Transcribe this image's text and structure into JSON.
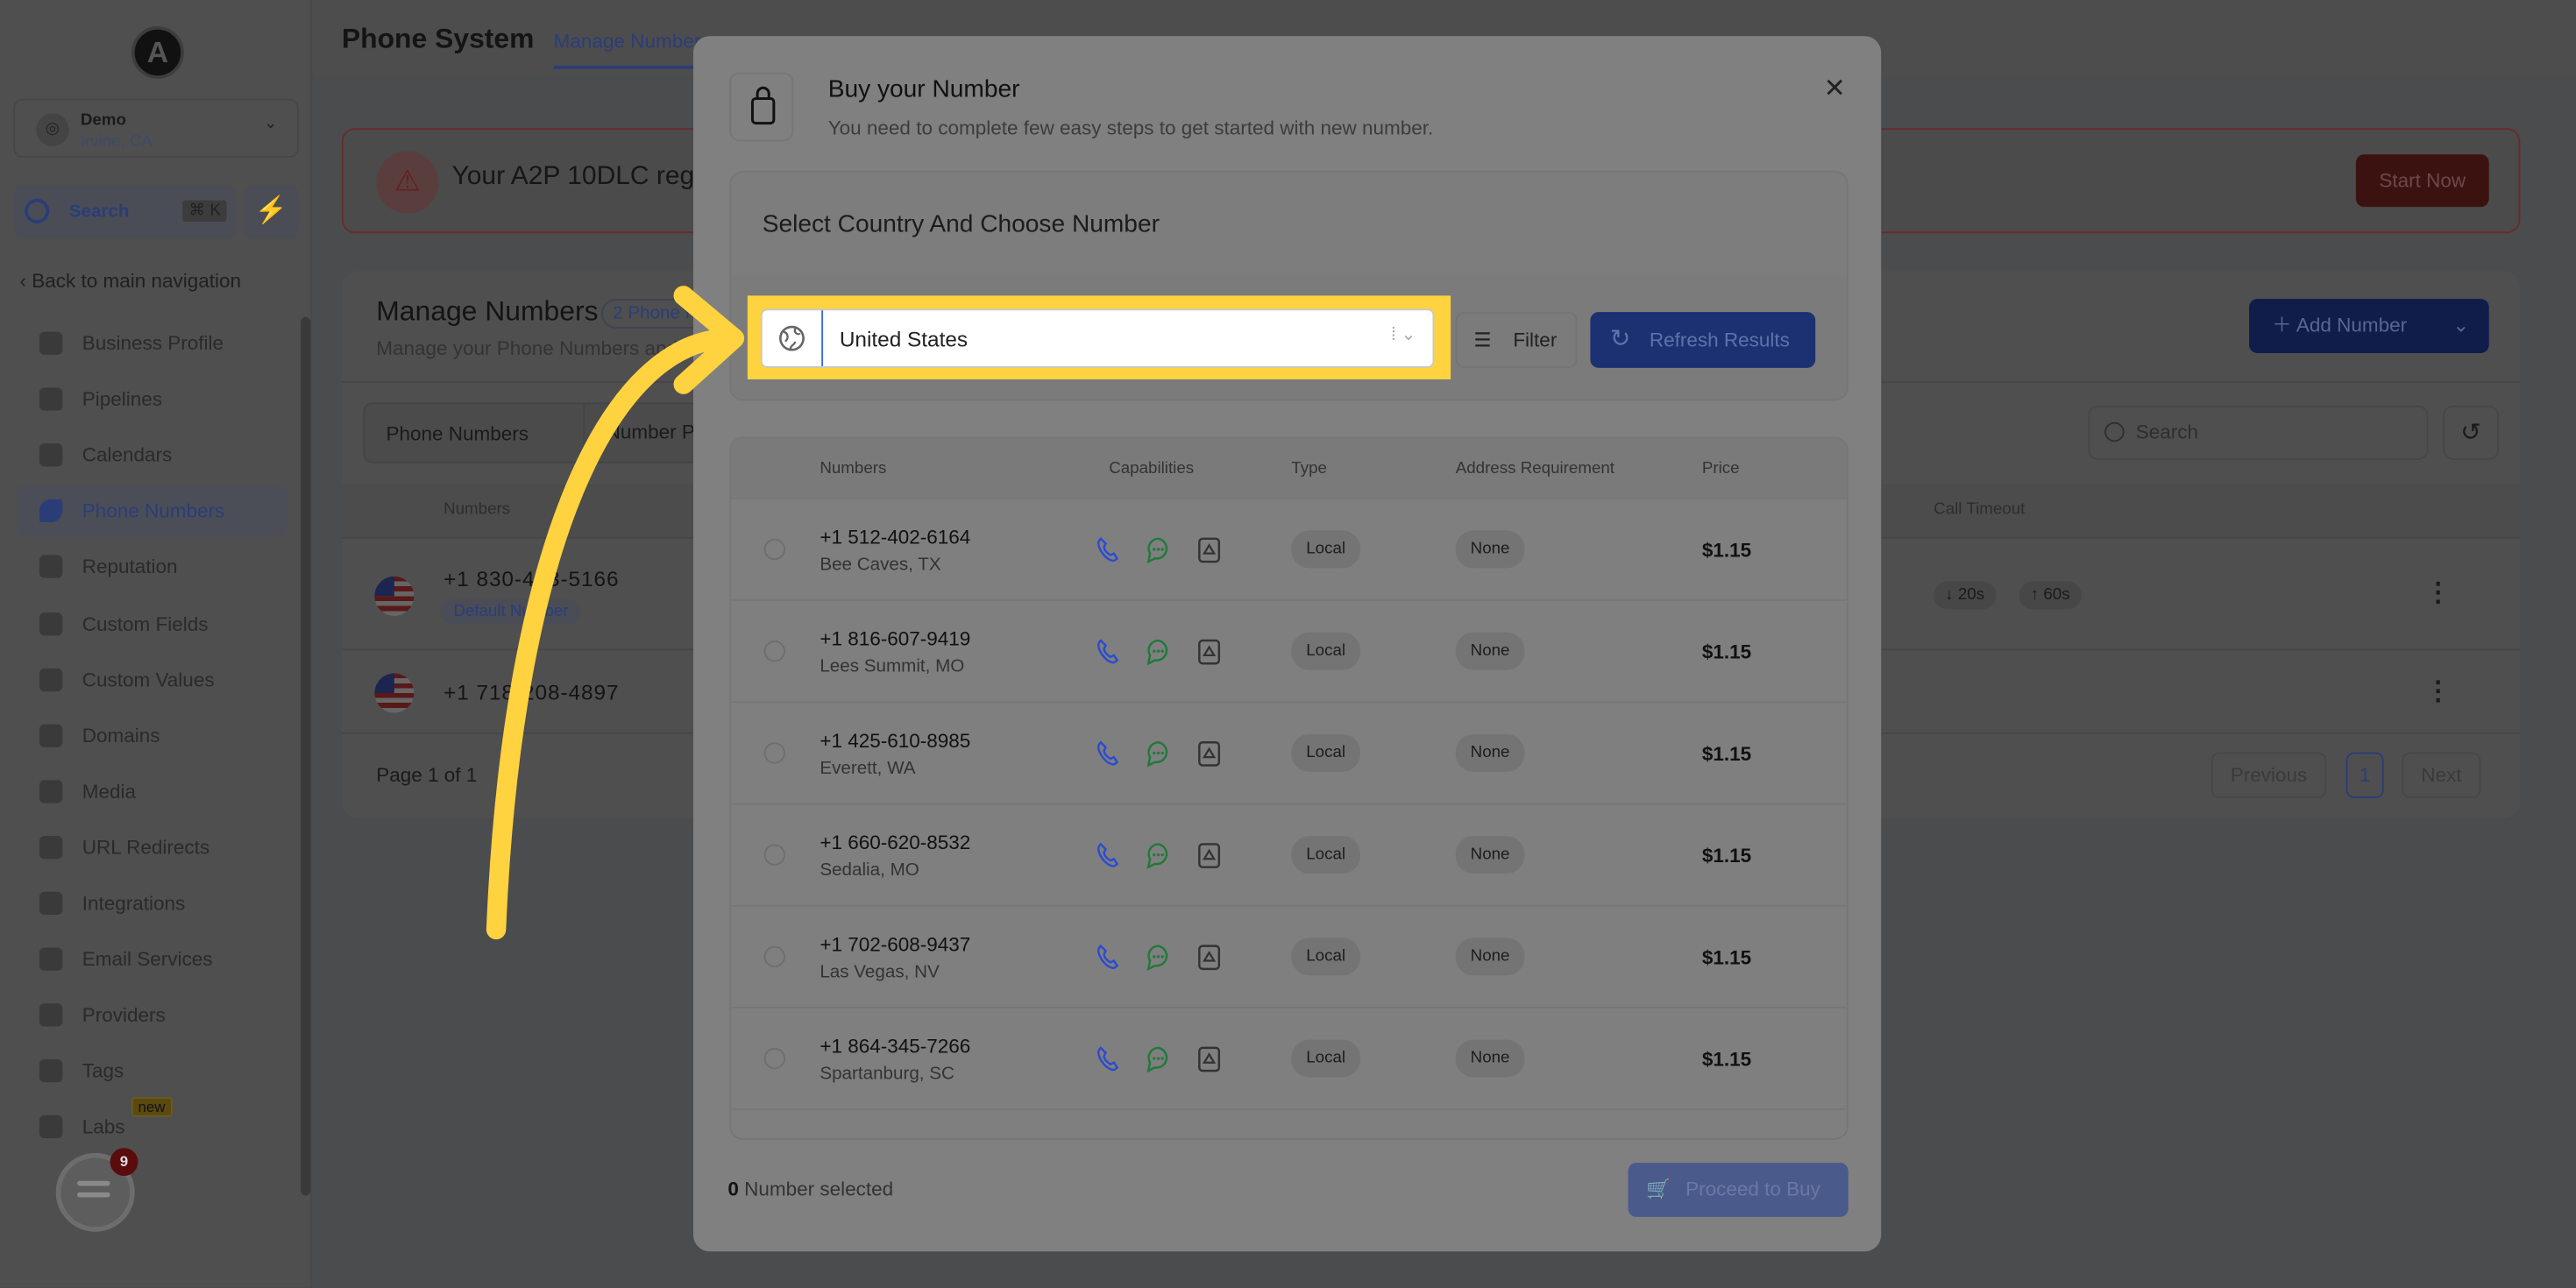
{
  "sidebar": {
    "logo_letter": "A",
    "account": {
      "name": "Demo",
      "location": "Irvine, CA"
    },
    "search": {
      "label": "Search",
      "shortcut": "⌘ K"
    },
    "back_label": "Back to main navigation",
    "items": [
      {
        "label": "Business Profile",
        "icon": "briefcase-icon"
      },
      {
        "label": "Pipelines",
        "icon": "funnel-icon"
      },
      {
        "label": "Calendars",
        "icon": "calendar-icon"
      },
      {
        "label": "Phone Numbers",
        "icon": "phone-icon",
        "active": true
      },
      {
        "label": "Reputation",
        "icon": "star-icon"
      },
      {
        "label": "Custom Fields",
        "icon": "text-field-icon"
      },
      {
        "label": "Custom Values",
        "icon": "diamond-icon"
      },
      {
        "label": "Domains",
        "icon": "globe-icon"
      },
      {
        "label": "Media",
        "icon": "video-icon"
      },
      {
        "label": "URL Redirects",
        "icon": "cursor-icon"
      },
      {
        "label": "Integrations",
        "icon": "branch-icon"
      },
      {
        "label": "Email Services",
        "icon": "mail-icon"
      },
      {
        "label": "Providers",
        "icon": "clipboard-check-icon"
      },
      {
        "label": "Tags",
        "icon": "tag-icon"
      },
      {
        "label": "Labs",
        "icon": "flask-icon",
        "badge": "new"
      }
    ],
    "chat_badge": "9"
  },
  "header": {
    "title": "Phone System",
    "active_tab": "Manage Numbers"
  },
  "alert": {
    "text": "Your A2P 10DLC reg",
    "button": "Start Now"
  },
  "manage": {
    "title": "Manage Numbers",
    "badge": "2 Phone N",
    "subtitle": "Manage your Phone Numbers and",
    "add_button": "Add Number",
    "tabs": [
      "Phone Numbers",
      "Number Po"
    ],
    "search_placeholder": "Search",
    "columns": {
      "numbers": "Numbers",
      "call_timeout": "Call Timeout"
    },
    "rows": [
      {
        "number": "+1 830-433-5166",
        "badge": "Default Number",
        "timeout_in": "20s",
        "timeout_out": "60s"
      },
      {
        "number": "+1 718-208-4897"
      }
    ],
    "pagination": {
      "label": "Page 1 of 1",
      "previous": "Previous",
      "current": "1",
      "next": "Next"
    }
  },
  "modal": {
    "title": "Buy your Number",
    "subtitle": "You need to complete few easy steps to get started with new number.",
    "section_title": "Select Country And Choose Number",
    "country": "United States",
    "filter_label": "Filter",
    "refresh_label": "Refresh Results",
    "columns": [
      "Numbers",
      "Capabilities",
      "Type",
      "Address Requirement",
      "Price"
    ],
    "rows": [
      {
        "number": "+1 512-402-6164",
        "city": "Bee Caves, TX",
        "type": "Local",
        "address": "None",
        "price": "$1.15"
      },
      {
        "number": "+1 816-607-9419",
        "city": "Lees Summit, MO",
        "type": "Local",
        "address": "None",
        "price": "$1.15"
      },
      {
        "number": "+1 425-610-8985",
        "city": "Everett, WA",
        "type": "Local",
        "address": "None",
        "price": "$1.15"
      },
      {
        "number": "+1 660-620-8532",
        "city": "Sedalia, MO",
        "type": "Local",
        "address": "None",
        "price": "$1.15"
      },
      {
        "number": "+1 702-608-9437",
        "city": "Las Vegas, NV",
        "type": "Local",
        "address": "None",
        "price": "$1.15"
      },
      {
        "number": "+1 864-345-7266",
        "city": "Spartanburg, SC",
        "type": "Local",
        "address": "None",
        "price": "$1.15"
      }
    ],
    "selected_count": "0",
    "selected_label": "Number selected",
    "proceed_label": "Proceed to Buy"
  },
  "colors": {
    "highlight": "#ffd23f",
    "primary": "#1c3172",
    "voice": "#2b4bd0",
    "sms": "#1f7a3a"
  }
}
